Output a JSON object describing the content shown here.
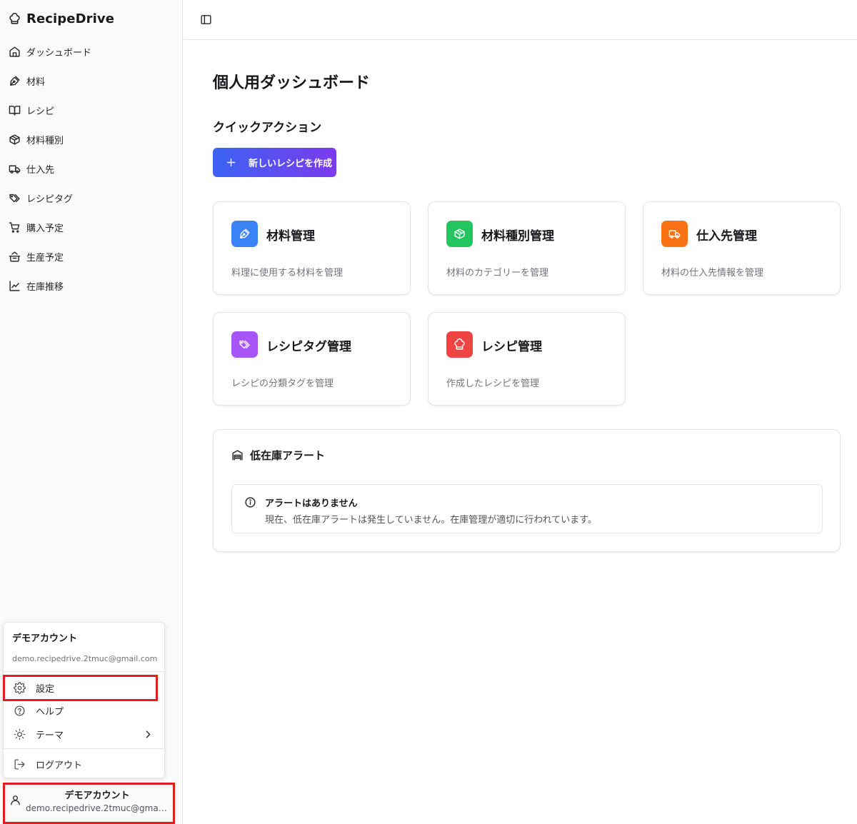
{
  "app": {
    "name": "RecipeDrive"
  },
  "sidebar": {
    "items": [
      {
        "label": "ダッシュボード",
        "icon": "home-icon"
      },
      {
        "label": "材料",
        "icon": "pen-tool-icon"
      },
      {
        "label": "レシピ",
        "icon": "book-open-icon"
      },
      {
        "label": "材料種別",
        "icon": "package-icon"
      },
      {
        "label": "仕入先",
        "icon": "truck-icon"
      },
      {
        "label": "レシピタグ",
        "icon": "tags-icon"
      },
      {
        "label": "購入予定",
        "icon": "cart-icon"
      },
      {
        "label": "生産予定",
        "icon": "cooking-pot-icon"
      },
      {
        "label": "在庫推移",
        "icon": "chart-line-icon"
      }
    ]
  },
  "account_menu": {
    "name": "デモアカウント",
    "email": "demo.recipedrive.2tmuc@gmail.com",
    "items": [
      {
        "label": "設定",
        "icon": "gear-icon"
      },
      {
        "label": "ヘルプ",
        "icon": "help-circle-icon"
      },
      {
        "label": "テーマ",
        "icon": "sun-icon"
      }
    ],
    "logout": "ログアウト"
  },
  "account_button": {
    "name": "デモアカウント",
    "email": "demo.recipedrive.2tmuc@gmail.com"
  },
  "main": {
    "title": "個人用ダッシュボード",
    "quick_actions_title": "クイックアクション",
    "create_button": "新しいレシピを作成",
    "cards": [
      {
        "title": "材料管理",
        "desc": "料理に使用する材料を管理",
        "color": "#3b82f6",
        "icon": "pen-tool-icon"
      },
      {
        "title": "材料種別管理",
        "desc": "材料のカテゴリーを管理",
        "color": "#22c55e",
        "icon": "package-icon"
      },
      {
        "title": "仕入先管理",
        "desc": "材料の仕入先情報を管理",
        "color": "#f97316",
        "icon": "truck-icon"
      },
      {
        "title": "レシピタグ管理",
        "desc": "レシピの分類タグを管理",
        "color": "#a855f7",
        "icon": "tags-icon"
      },
      {
        "title": "レシピ管理",
        "desc": "作成したレシピを管理",
        "color": "#ef4444",
        "icon": "chef-hat-icon"
      }
    ],
    "alert_section": {
      "title": "低在庫アラート",
      "box_title": "アラートはありません",
      "box_desc": "現在、低在庫アラートは発生していません。在庫管理が適切に行われています。"
    }
  },
  "colors": {
    "accent_start": "#3b63f4",
    "accent_end": "#7c3aed",
    "highlight": "#e11d24"
  }
}
